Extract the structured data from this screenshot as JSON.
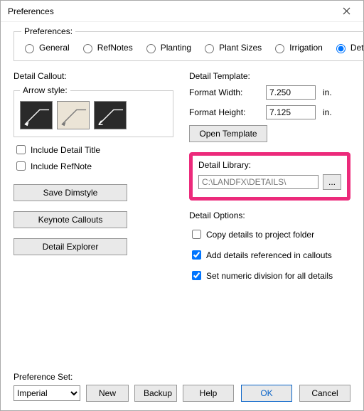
{
  "window": {
    "title": "Preferences"
  },
  "prefs_group": {
    "legend": "Preferences:",
    "options": {
      "general": "General",
      "refnotes": "RefNotes",
      "planting": "Planting",
      "plant_sizes": "Plant Sizes",
      "irrigation": "Irrigation",
      "details": "Details"
    },
    "selected": "details"
  },
  "detail_callout": {
    "legend": "Detail Callout:",
    "arrow_legend": "Arrow style:",
    "include_detail_title": "Include Detail Title",
    "include_refnote": "Include RefNote",
    "save_dimstyle": "Save Dimstyle",
    "keynote_callouts": "Keynote Callouts",
    "detail_explorer": "Detail Explorer"
  },
  "detail_template": {
    "legend": "Detail Template:",
    "format_width_label": "Format Width:",
    "format_width_value": "7.250",
    "format_height_label": "Format Height:",
    "format_height_value": "7.125",
    "unit": "in.",
    "open_template": "Open Template"
  },
  "detail_library": {
    "legend": "Detail Library:",
    "path": "C:\\LANDFX\\DETAILS\\",
    "browse": "..."
  },
  "detail_options": {
    "legend": "Detail Options:",
    "copy_details": "Copy details to project folder",
    "add_details": "Add details referenced in callouts",
    "set_numeric": "Set numeric division for all details"
  },
  "pref_set": {
    "label": "Preference Set:",
    "value": "Imperial",
    "new": "New",
    "backup": "Backup"
  },
  "buttons": {
    "help": "Help",
    "ok": "OK",
    "cancel": "Cancel"
  }
}
